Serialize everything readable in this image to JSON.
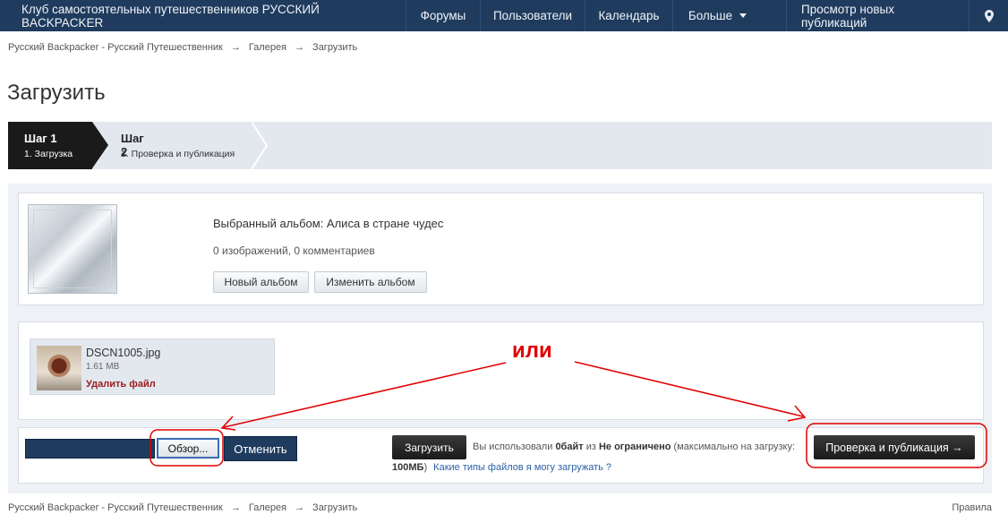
{
  "nav": {
    "brand": "Клуб самостоятельных путешественников РУССКИЙ BACKPACKER",
    "forums": "Форумы",
    "users": "Пользователи",
    "calendar": "Календарь",
    "more": "Больше",
    "new_posts": "Просмотр новых публикаций",
    "pin_icon": "map-pin-icon"
  },
  "breadcrumb": {
    "home": "Русский Backpacker - Русский Путешественник",
    "gallery": "Галерея",
    "current": "Загрузить",
    "separator": "→"
  },
  "page_title": "Загрузить",
  "steps": {
    "step1_title": "Шаг 1",
    "step1_sub": "1. Загрузка",
    "step2_title": "Шаг 2",
    "step2_sub": "2. Проверка и публикация"
  },
  "album": {
    "name": "Выбранный альбом: Алиса в стране чудес",
    "stats": "0 изображений, 0 комментариев",
    "new_album": "Новый альбом",
    "change_album": "Изменить альбом"
  },
  "file": {
    "name": "DSCN1005.jpg",
    "size": "1.61 MB",
    "delete": "Удалить файл"
  },
  "upload": {
    "browse": "Обзор...",
    "cancel": "Отменить",
    "upload_button": "Загрузить",
    "usage_prefix": "Вы использовали",
    "used": "0байт",
    "of": "из",
    "limit": "Не ограничено",
    "max_prefix": "(максимально на загрузку:",
    "max_value": "100МБ",
    "max_suffix": ")",
    "types_link": "Какие типы файлов я могу загружать ?",
    "review_button": "Проверка и публикация →"
  },
  "annotation": {
    "ili": "или",
    "color": "#e00000"
  },
  "footer": {
    "rules": "Правила"
  }
}
